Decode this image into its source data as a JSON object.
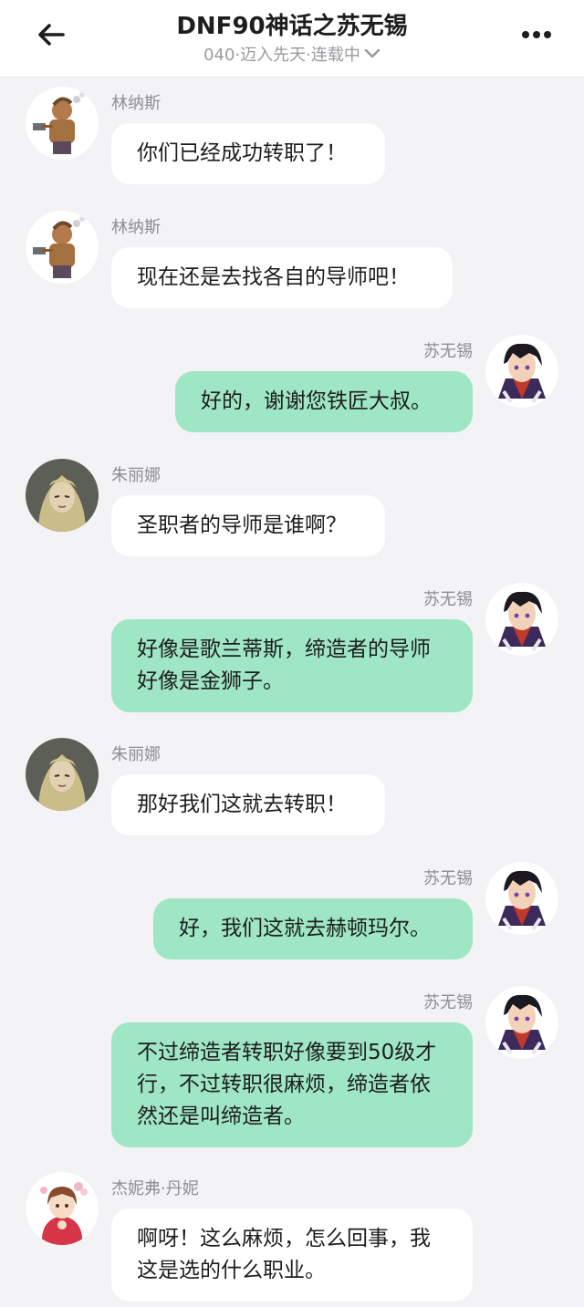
{
  "header": {
    "title": "DNF90神话之苏无锡",
    "subtitle": "040·迈入先天·连载中",
    "back_icon": "arrow-left-icon",
    "more_icon": "more-dots-icon",
    "chevron_icon": "chevron-down-icon"
  },
  "messages": [
    {
      "side": "left",
      "sender": "林纳斯",
      "text": "你们已经成功转职了！",
      "avatar": "linus"
    },
    {
      "side": "left",
      "sender": "林纳斯",
      "text": "现在还是去找各自的导师吧！",
      "avatar": "linus"
    },
    {
      "side": "right",
      "sender": "苏无锡",
      "text": "好的，谢谢您铁匠大叔。",
      "avatar": "suwuxi"
    },
    {
      "side": "left",
      "sender": "朱丽娜",
      "text": "圣职者的导师是谁啊？",
      "avatar": "zhulina"
    },
    {
      "side": "right",
      "sender": "苏无锡",
      "text": "好像是歌兰蒂斯，缔造者的导师好像是金狮子。",
      "avatar": "suwuxi"
    },
    {
      "side": "left",
      "sender": "朱丽娜",
      "text": "那好我们这就去转职！",
      "avatar": "zhulina"
    },
    {
      "side": "right",
      "sender": "苏无锡",
      "text": "好，我们这就去赫顿玛尔。",
      "avatar": "suwuxi"
    },
    {
      "side": "right",
      "sender": "苏无锡",
      "text": "不过缔造者转职好像要到50级才行，不过转职很麻烦，缔造者依然还是叫缔造者。",
      "avatar": "suwuxi"
    },
    {
      "side": "left",
      "sender": "杰妮弗·丹妮",
      "text": "啊呀！这么麻烦，怎么回事，我这是选的什么职业。",
      "avatar": "jennifer"
    }
  ],
  "colors": {
    "background": "#f3f3f5",
    "left_bubble": "#ffffff",
    "right_bubble": "#9fe6c4",
    "sender_text": "#8e8e93"
  }
}
